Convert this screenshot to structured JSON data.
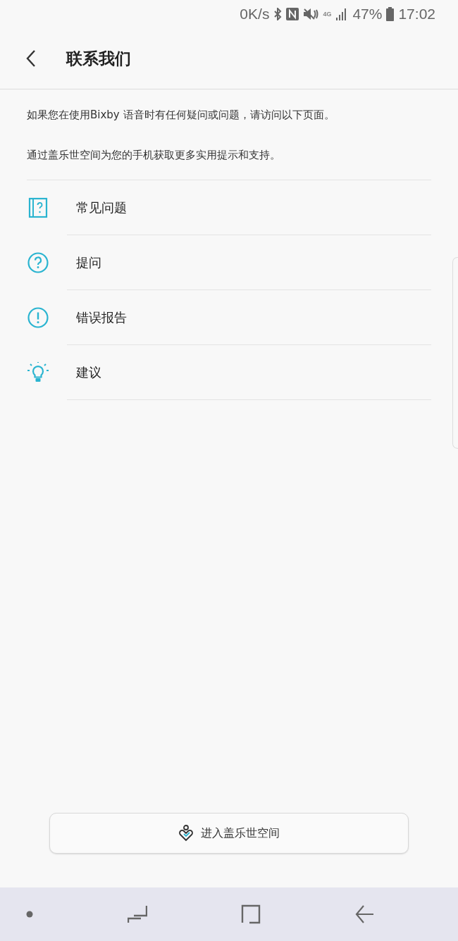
{
  "status_bar": {
    "speed": "0K/s",
    "network": "4G",
    "battery": "47%",
    "time": "17:02"
  },
  "header": {
    "title": "联系我们"
  },
  "intro": [
    "如果您在使用Bixby 语音时有任何疑问或问题，请访问以下页面。",
    "通过盖乐世空间为您的手机获取更多实用提示和支持。"
  ],
  "items": [
    {
      "kind": "faq",
      "label": "常见问题"
    },
    {
      "kind": "ask",
      "label": "提问"
    },
    {
      "kind": "error",
      "label": "错误报告"
    },
    {
      "kind": "suggest",
      "label": "建议"
    }
  ],
  "button": {
    "label": "进入盖乐世空间"
  }
}
